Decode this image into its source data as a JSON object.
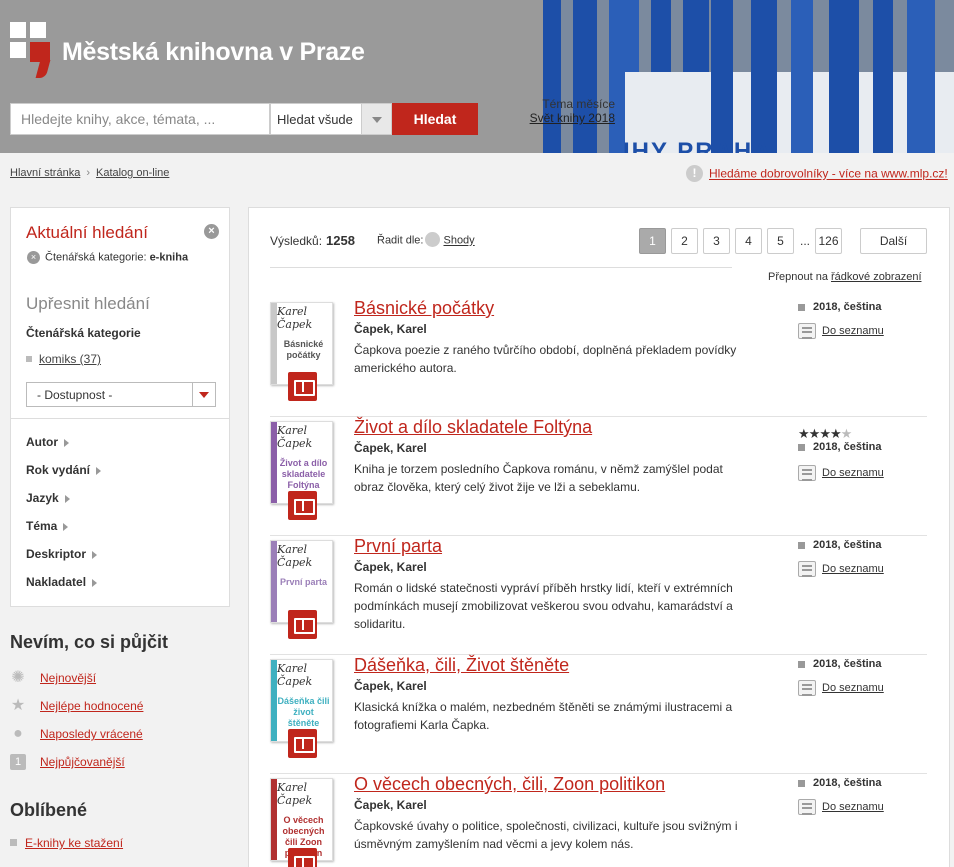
{
  "header": {
    "site_title": "Městská knihovna v Praze",
    "search_placeholder": "Hledejte knihy, akce, témata, ...",
    "search_scope": "Hledat všude",
    "search_button": "Hledat",
    "month_label": "Téma měsíce",
    "month_link": "Svět knihy 2018",
    "banner_text": "IHY PRAHA",
    "colors": {
      "accent": "#c0261c",
      "header_bg": "#9a9a9a",
      "banner_blue": "#1d4fa8"
    }
  },
  "breadcrumb": {
    "home": "Hlavní stránka",
    "catalog": "Katalog on-line"
  },
  "volunteer": {
    "icon": "!",
    "text": "Hledáme dobrovolníky - více na www.mlp.cz!"
  },
  "sidebar": {
    "current_title": "Aktuální hledání",
    "filter_label": "Čtenářská kategorie:",
    "filter_value": "e-kniha",
    "refine_title": "Upřesnit hledání",
    "category_heading": "Čtenářská kategorie",
    "category_item": "komiks (37)",
    "availability": "- Dostupnost -",
    "facets": [
      "Autor",
      "Rok vydání",
      "Jazyk",
      "Téma",
      "Deskriptor",
      "Nakladatel"
    ]
  },
  "suggest": {
    "title": "Nevím, co si půjčit",
    "items": [
      "Nejnovější",
      "Nejlépe hodnocené",
      "Naposledy vrácené",
      "Nejpůjčovanější"
    ],
    "icons": [
      "burst-icon",
      "star-icon",
      "return-icon",
      "rank-one-icon"
    ],
    "rank_badge": "1"
  },
  "favorites": {
    "title": "Oblíbené",
    "item": "E-knihy ke stažení"
  },
  "results": {
    "count_label": "Výsledků:",
    "count": "1258",
    "sort_label": "Řadit dle:",
    "sort_value": "Shody",
    "pages": [
      "1",
      "2",
      "3",
      "4",
      "5"
    ],
    "dots": "...",
    "last_page": "126",
    "next": "Další",
    "switch_label": "Přepnout na",
    "switch_link": "řádkové zobrazení",
    "to_list": "Do seznamu",
    "items": [
      {
        "title": "Básnické počátky",
        "author": "Čapek, Karel",
        "desc": "Čapkova poezie z raného tvůrčího období, doplněná překladem povídky amerického autora.",
        "year": "2018",
        "lang": ", čeština",
        "cover_title": "Básnické počátky",
        "cover_color": "#c8c8c8",
        "rating": 0
      },
      {
        "title": "Život a dílo skladatele Foltýna",
        "author": "Čapek, Karel",
        "desc": "Kniha je torzem posledního Čapkova románu, v němž zamýšlel podat obraz člověka, který celý život žije ve lži a sebeklamu.",
        "year": "2018",
        "lang": ", čeština",
        "cover_title": "Život a dílo skladatele Foltýna",
        "cover_color": "#8b5fa8",
        "rating": 4
      },
      {
        "title": "První parta",
        "author": "Čapek, Karel",
        "desc": "Román o lidské statečnosti vypráví příběh hrstky lidí, kteří v extrémních podmínkách musejí zmobilizovat veškerou svou odvahu, kamarádství a solidaritu.",
        "year": "2018",
        "lang": ", čeština",
        "cover_title": "První parta",
        "cover_color": "#9b7fb8",
        "rating": 0
      },
      {
        "title": "Dášeňka, čili, Život štěněte",
        "author": "Čapek, Karel",
        "desc": "Klasická knížka o malém, nezbedném štěněti se známými ilustracemi a fotografiemi Karla Čapka.",
        "year": "2018",
        "lang": ", čeština",
        "cover_title": "Dášeňka čili život štěněte",
        "cover_color": "#3fb0c0",
        "rating": 0
      },
      {
        "title": "O věcech obecných, čili, Zoon politikon",
        "author": "Čapek, Karel",
        "desc": "Čapkovské úvahy o politice, společnosti, civilizaci, kultuře jsou svižným i úsměvným zamyšlením nad věcmi a jevy kolem nás.",
        "year": "2018",
        "lang": ", čeština",
        "cover_title": "O věcech obecných čili Zoon politikon",
        "cover_color": "#b03030",
        "rating": 0
      }
    ],
    "cover_signature": "Karel Čapek"
  }
}
